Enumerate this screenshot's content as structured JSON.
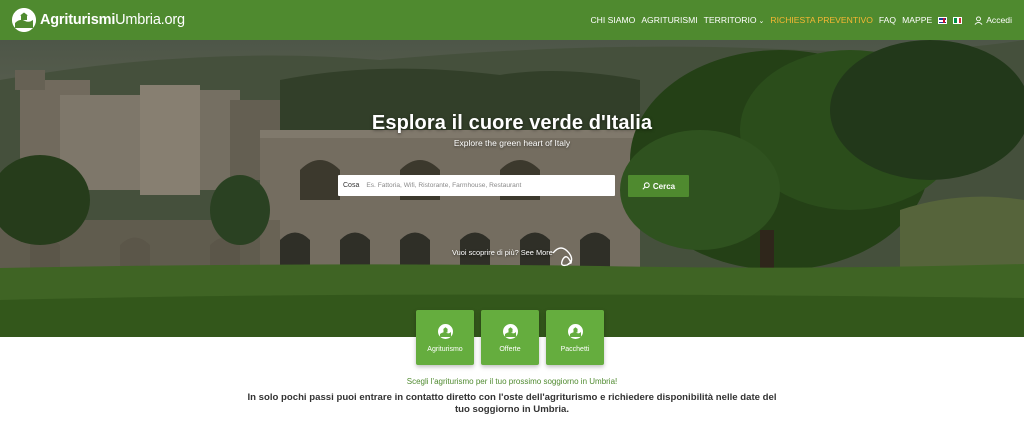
{
  "brand": {
    "logo_bold": "Agriturismi",
    "logo_rest": "Umbria.org"
  },
  "nav": {
    "items": [
      {
        "label": "CHI SIAMO"
      },
      {
        "label": "AGRITURISMI"
      },
      {
        "label": "TERRITORIO"
      },
      {
        "label": "RICHIESTA PREVENTIVO"
      },
      {
        "label": "FAQ"
      },
      {
        "label": "MAPPE"
      }
    ],
    "login_label": "Accedi",
    "highlight_color": "#f7b733"
  },
  "hero": {
    "title": "Esplora il cuore verde d'Italia",
    "subtitle": "Explore the green heart of Italy",
    "search_label": "Cosa",
    "search_placeholder": "Es. Fattoria, Wifi, Ristorante, Farmhouse, Restaurant",
    "search_button": "Cerca",
    "discover_text": "Vuoi scoprire di più? See More"
  },
  "categories": [
    {
      "label": "Agriturismo"
    },
    {
      "label": "Offerte"
    },
    {
      "label": "Pacchetti"
    }
  ],
  "content": {
    "tagline": "Scegli l'agriturismo per il tuo prossimo soggiorno in Umbria!",
    "intro": "In solo pochi passi puoi entrare in contatto diretto con l'oste dell'agriturismo e richiedere disponibilità nelle date del tuo soggiorno in Umbria."
  },
  "colors": {
    "brand_green": "#4f8a2f",
    "card_green": "#65ad3e",
    "tagline_green": "#4f8a2f"
  },
  "icons": [
    "logo-icon",
    "chevron-down-icon",
    "uk-flag-icon",
    "italy-flag-icon",
    "user-icon",
    "search-icon",
    "curly-arrow-icon",
    "farmhouse-icon"
  ]
}
